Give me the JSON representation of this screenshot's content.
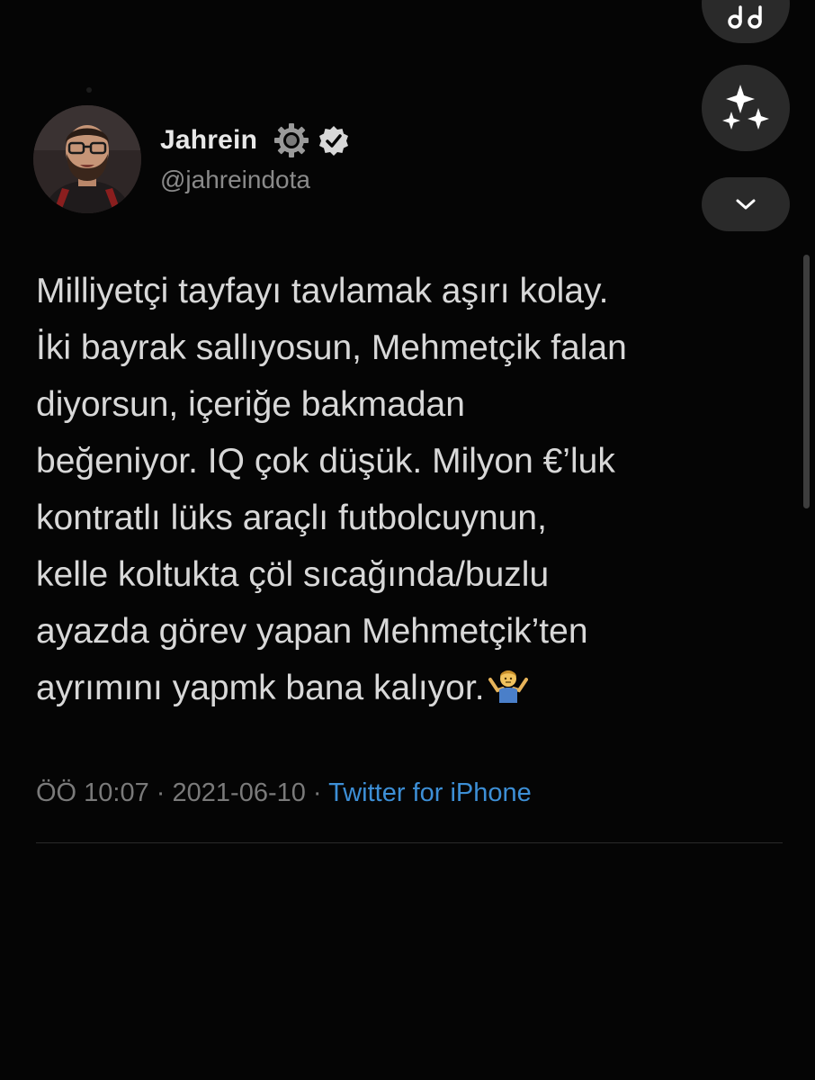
{
  "tweet": {
    "author": {
      "display_name": "Jahrein",
      "handle": "@jahreindota",
      "badges": [
        "gear-icon",
        "verified-icon"
      ]
    },
    "text": "Milliyetçi tayfayı tavlamak aşırı kolay.\nİki bayrak sallıyosun, Mehmetçik falan\ndiyorsun, içeriğe bakmadan\nbeğeniyor. IQ çok düşük. Milyon €’luk\nkontratlı lüks araçlı futbolcuynun,\nkelle koltukta çöl sıcağında/buzlu\nayazda görev yapan Mehmetçik’ten\nayrımını yapmk bana kalıyor.",
    "emoji": "person-shrugging",
    "time": "ÖÖ 10:07",
    "separator": " · ",
    "date": "2021-06-10",
    "source": "Twitter for iPhone"
  },
  "floating_buttons": [
    "music-icon",
    "sparkle-icon",
    "chevron-down-icon"
  ],
  "colors": {
    "background": "#050505",
    "text": "#d8d8d8",
    "secondary_text": "#7a7a7a",
    "link": "#3d8fd6",
    "button_bg": "#2a2a2a"
  }
}
